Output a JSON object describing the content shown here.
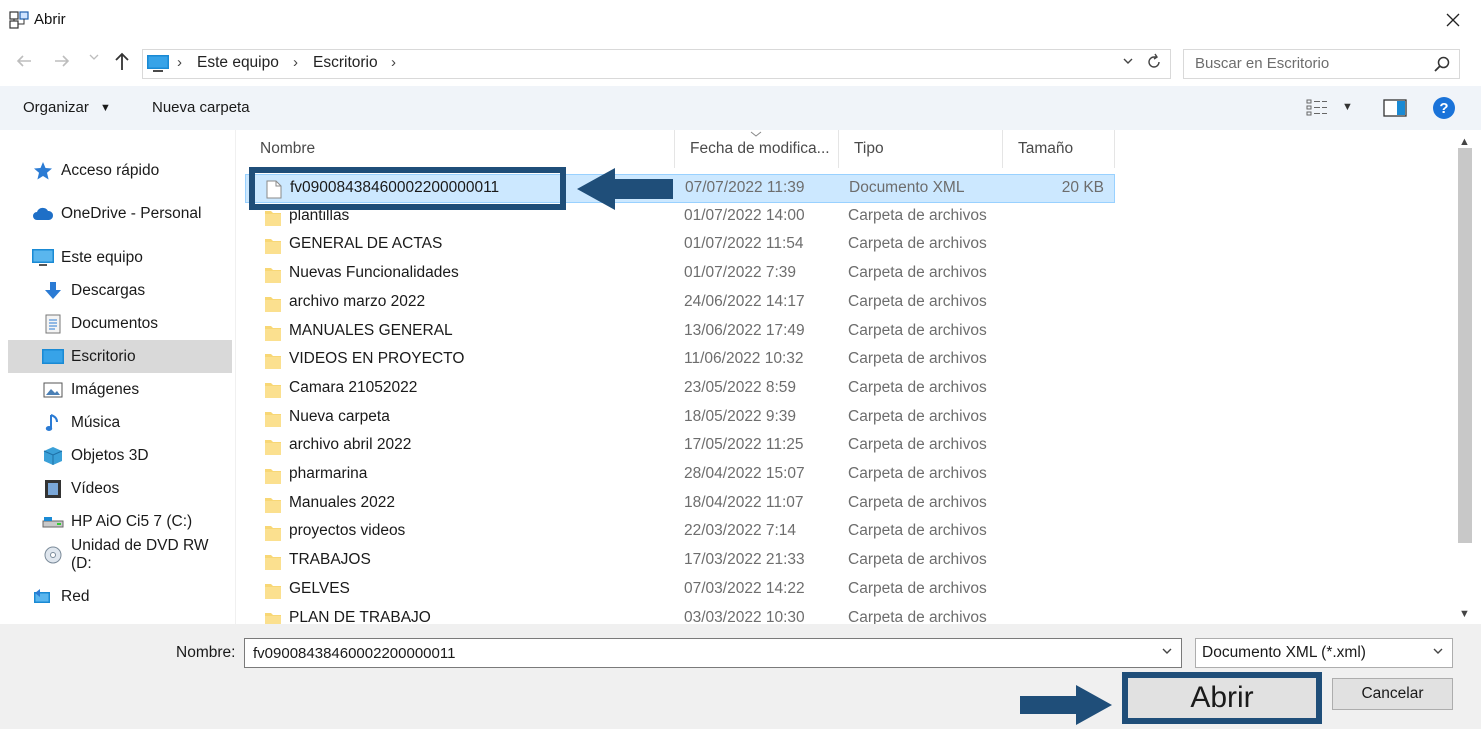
{
  "window": {
    "title": "Abrir"
  },
  "nav": {
    "breadcrumbs": [
      "Este equipo",
      "Escritorio"
    ],
    "search_placeholder": "Buscar en Escritorio"
  },
  "commands": {
    "organize": "Organizar",
    "new_folder": "Nueva carpeta"
  },
  "sidebar": {
    "items": [
      {
        "label": "Acceso rápido",
        "icon": "star-icon"
      },
      {
        "label": "OneDrive - Personal",
        "icon": "cloud-icon"
      },
      {
        "label": "Este equipo",
        "icon": "computer-icon"
      },
      {
        "label": "Descargas",
        "icon": "download-icon"
      },
      {
        "label": "Documentos",
        "icon": "document-icon"
      },
      {
        "label": "Escritorio",
        "icon": "desktop-icon",
        "selected": true
      },
      {
        "label": "Imágenes",
        "icon": "pictures-icon"
      },
      {
        "label": "Música",
        "icon": "music-icon"
      },
      {
        "label": "Objetos 3D",
        "icon": "cube-icon"
      },
      {
        "label": "Vídeos",
        "icon": "video-icon"
      },
      {
        "label": "HP AiO Ci5 7 (C:)",
        "icon": "drive-icon"
      },
      {
        "label": "Unidad de DVD RW (D:",
        "icon": "dvd-icon"
      },
      {
        "label": "Red",
        "icon": "network-icon"
      }
    ]
  },
  "columns": {
    "name": "Nombre",
    "date": "Fecha de modifica...",
    "type": "Tipo",
    "size": "Tamaño"
  },
  "files": [
    {
      "name": "fv09008438460002200000011",
      "date": "07/07/2022 11:39",
      "type": "Documento XML",
      "size": "20 KB",
      "kind": "file",
      "selected": true
    },
    {
      "name": "plantillas",
      "date": "01/07/2022 14:00",
      "type": "Carpeta de archivos",
      "size": "",
      "kind": "folder"
    },
    {
      "name": "GENERAL DE ACTAS",
      "date": "01/07/2022 11:54",
      "type": "Carpeta de archivos",
      "size": "",
      "kind": "folder"
    },
    {
      "name": "Nuevas Funcionalidades",
      "date": "01/07/2022 7:39",
      "type": "Carpeta de archivos",
      "size": "",
      "kind": "folder"
    },
    {
      "name": "archivo marzo 2022",
      "date": "24/06/2022 14:17",
      "type": "Carpeta de archivos",
      "size": "",
      "kind": "folder"
    },
    {
      "name": "MANUALES GENERAL",
      "date": "13/06/2022 17:49",
      "type": "Carpeta de archivos",
      "size": "",
      "kind": "folder"
    },
    {
      "name": "VIDEOS EN PROYECTO",
      "date": "11/06/2022 10:32",
      "type": "Carpeta de archivos",
      "size": "",
      "kind": "folder"
    },
    {
      "name": "Camara 21052022",
      "date": "23/05/2022 8:59",
      "type": "Carpeta de archivos",
      "size": "",
      "kind": "folder"
    },
    {
      "name": "Nueva carpeta",
      "date": "18/05/2022 9:39",
      "type": "Carpeta de archivos",
      "size": "",
      "kind": "folder"
    },
    {
      "name": "archivo abril 2022",
      "date": "17/05/2022 11:25",
      "type": "Carpeta de archivos",
      "size": "",
      "kind": "folder"
    },
    {
      "name": "pharmarina",
      "date": "28/04/2022 15:07",
      "type": "Carpeta de archivos",
      "size": "",
      "kind": "folder"
    },
    {
      "name": "Manuales 2022",
      "date": "18/04/2022 11:07",
      "type": "Carpeta de archivos",
      "size": "",
      "kind": "folder"
    },
    {
      "name": "proyectos videos",
      "date": "22/03/2022 7:14",
      "type": "Carpeta de archivos",
      "size": "",
      "kind": "folder"
    },
    {
      "name": "TRABAJOS",
      "date": "17/03/2022 21:33",
      "type": "Carpeta de archivos",
      "size": "",
      "kind": "folder"
    },
    {
      "name": "GELVES",
      "date": "07/03/2022 14:22",
      "type": "Carpeta de archivos",
      "size": "",
      "kind": "folder"
    },
    {
      "name": "PLAN DE TRABAJO",
      "date": "03/03/2022 10:30",
      "type": "Carpeta de archivos",
      "size": "",
      "kind": "folder"
    }
  ],
  "bottom": {
    "name_label": "Nombre:",
    "name_value": "fv09008438460002200000011",
    "file_type": "Documento XML (*.xml)",
    "open_label": "Abrir",
    "cancel_label": "Cancelar"
  },
  "colors": {
    "annotation": "#1f4e79",
    "selection_bg": "#cce8ff",
    "folder": "#f8d775"
  }
}
